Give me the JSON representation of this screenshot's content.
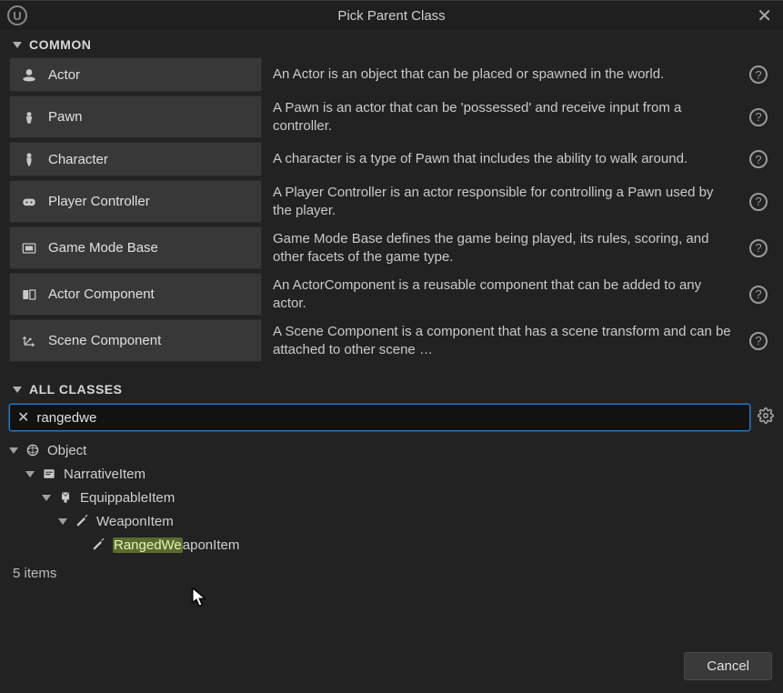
{
  "window": {
    "title": "Pick Parent Class"
  },
  "sections": {
    "common_label": "COMMON",
    "all_classes_label": "ALL CLASSES"
  },
  "common": [
    {
      "icon": "actor",
      "label": "Actor",
      "desc": "An Actor is an object that can be placed or spawned in the world."
    },
    {
      "icon": "pawn",
      "label": "Pawn",
      "desc": "A Pawn is an actor that can be 'possessed' and receive input from a controller."
    },
    {
      "icon": "character",
      "label": "Character",
      "desc": "A character is a type of Pawn that includes the ability to walk around."
    },
    {
      "icon": "controller",
      "label": "Player Controller",
      "desc": "A Player Controller is an actor responsible for controlling a Pawn used by the player."
    },
    {
      "icon": "gamemode",
      "label": "Game Mode Base",
      "desc": "Game Mode Base defines the game being played, its rules, scoring, and other facets of the game type."
    },
    {
      "icon": "actorcomp",
      "label": "Actor Component",
      "desc": "An ActorComponent is a reusable component that can be added to any actor."
    },
    {
      "icon": "scenecomp",
      "label": "Scene Component",
      "desc": "A Scene Component is a component that has a scene transform and can be attached to other scene …"
    }
  ],
  "search": {
    "value": "rangedwe"
  },
  "tree": [
    {
      "depth": 0,
      "icon": "object",
      "label": "Object",
      "expandable": true
    },
    {
      "depth": 1,
      "icon": "narrative",
      "label": "NarrativeItem",
      "expandable": true
    },
    {
      "depth": 2,
      "icon": "equip",
      "label": "EquippableItem",
      "expandable": true
    },
    {
      "depth": 3,
      "icon": "weapon",
      "label": "WeaponItem",
      "expandable": true
    },
    {
      "depth": 4,
      "icon": "weapon",
      "label": "RangedWeaponItem",
      "expandable": false,
      "highlight_prefix": "RangedWe",
      "highlight_suffix": "aponItem"
    }
  ],
  "item_count": "5 items",
  "buttons": {
    "cancel": "Cancel"
  }
}
